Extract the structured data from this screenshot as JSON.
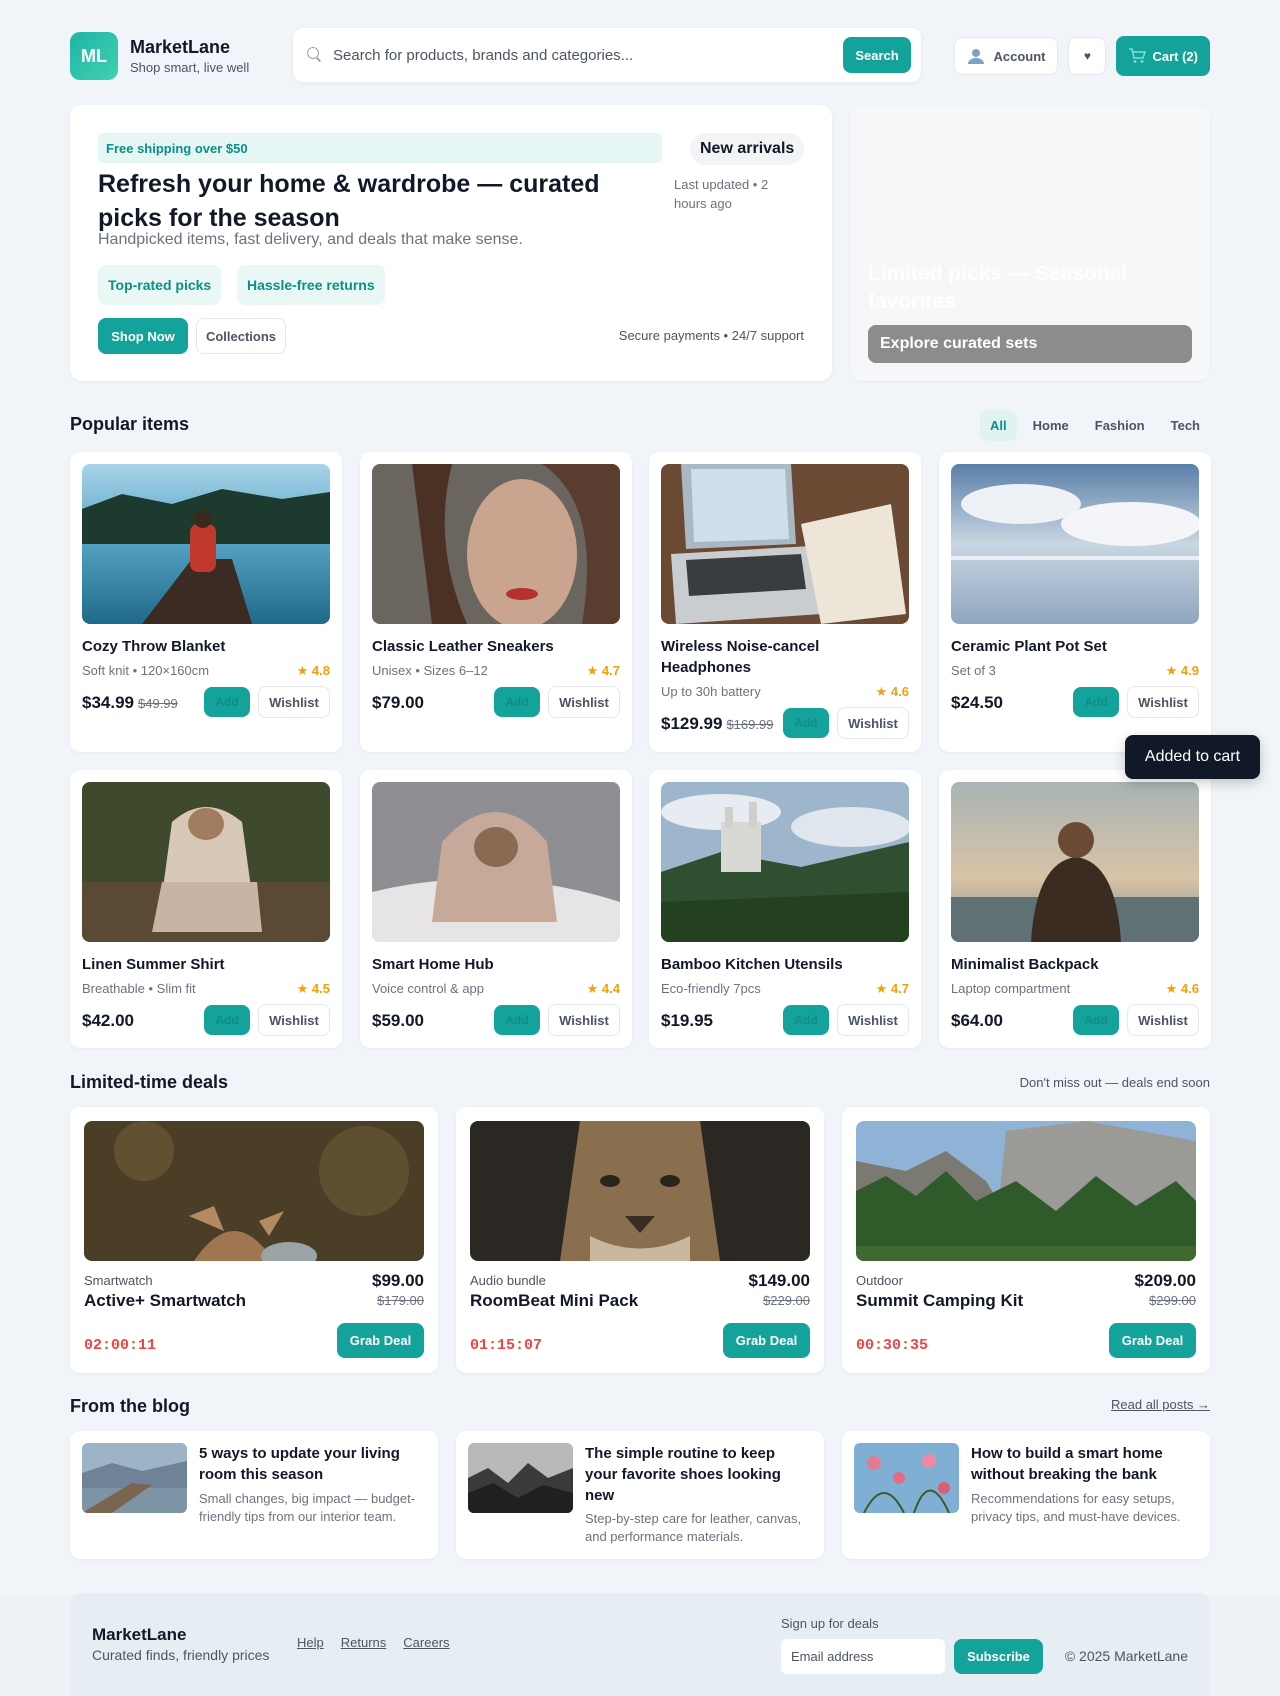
{
  "header": {
    "logo_initials": "ML",
    "brand_name": "MarketLane",
    "tagline": "Shop smart, live well",
    "search_placeholder": "Search for products, brands and categories...",
    "search_label": "Search",
    "account_label": "Account",
    "wishlist_icon": "♥",
    "cart_label": "Cart (2)"
  },
  "hero": {
    "badge": "Free shipping over $50",
    "title": "Refresh your home & wardrobe — curated picks for the season",
    "subtitle": "Handpicked items, fast delivery, and deals that make sense.",
    "pills": [
      "Top-rated picks",
      "Hassle-free returns"
    ],
    "new_arrivals": "New arrivals",
    "last_updated": "Last updated • 2 hours ago",
    "shop_now": "Shop Now",
    "collections": "Collections",
    "footnote": "Secure payments • 24/7 support"
  },
  "promo": {
    "title": "Limited picks — Seasonal favorites",
    "button": "Explore curated sets"
  },
  "popular": {
    "title": "Popular items",
    "filters": [
      "All",
      "Home",
      "Fashion",
      "Tech"
    ],
    "add_label": "Add",
    "wishlist_label": "Wishlist",
    "items": [
      {
        "name": "Cozy Throw Blanket",
        "meta": "Soft knit • 120×160cm",
        "rating": "4.8",
        "price": "$34.99",
        "old_price": "$49.99"
      },
      {
        "name": "Classic Leather Sneakers",
        "meta": "Unisex • Sizes 6–12",
        "rating": "4.7",
        "price": "$79.00",
        "old_price": ""
      },
      {
        "name": "Wireless Noise-cancel Headphones",
        "meta": "Up to 30h battery",
        "rating": "4.6",
        "price": "$129.99",
        "old_price": "$169.99"
      },
      {
        "name": "Ceramic Plant Pot Set",
        "meta": "Set of 3",
        "rating": "4.9",
        "price": "$24.50",
        "old_price": ""
      },
      {
        "name": "Linen Summer Shirt",
        "meta": "Breathable • Slim fit",
        "rating": "4.5",
        "price": "$42.00",
        "old_price": ""
      },
      {
        "name": "Smart Home Hub",
        "meta": "Voice control & app",
        "rating": "4.4",
        "price": "$59.00",
        "old_price": ""
      },
      {
        "name": "Bamboo Kitchen Utensils",
        "meta": "Eco-friendly 7pcs",
        "rating": "4.7",
        "price": "$19.95",
        "old_price": ""
      },
      {
        "name": "Minimalist Backpack",
        "meta": "Laptop compartment",
        "rating": "4.6",
        "price": "$64.00",
        "old_price": ""
      }
    ]
  },
  "toast": "Added to cart",
  "deals": {
    "title": "Limited-time deals",
    "note": "Don't miss out — deals end soon",
    "grab_label": "Grab Deal",
    "items": [
      {
        "category": "Smartwatch",
        "name": "Active+ Smartwatch",
        "price": "$99.00",
        "old_price": "$179.00",
        "timer": "02:00:11"
      },
      {
        "category": "Audio bundle",
        "name": "RoomBeat Mini Pack",
        "price": "$149.00",
        "old_price": "$229.00",
        "timer": "01:15:07"
      },
      {
        "category": "Outdoor",
        "name": "Summit Camping Kit",
        "price": "$209.00",
        "old_price": "$299.00",
        "timer": "00:30:35"
      }
    ]
  },
  "blog": {
    "title": "From the blog",
    "read_all": "Read all posts →",
    "posts": [
      {
        "title": "5 ways to update your living room this season",
        "desc": "Small changes, big impact — budget-friendly tips from our interior team."
      },
      {
        "title": "The simple routine to keep your favorite shoes looking new",
        "desc": "Step-by-step care for leather, canvas, and performance materials."
      },
      {
        "title": "How to build a smart home without breaking the bank",
        "desc": "Recommendations for easy setups, privacy tips, and must-have devices."
      }
    ]
  },
  "footer": {
    "brand": "MarketLane",
    "tagline": "Curated finds, friendly prices",
    "links": [
      "Help",
      "Returns",
      "Careers"
    ],
    "signup_label": "Sign up for deals",
    "email_placeholder": "Email address",
    "subscribe": "Subscribe",
    "copyright": "© 2025 MarketLane"
  }
}
